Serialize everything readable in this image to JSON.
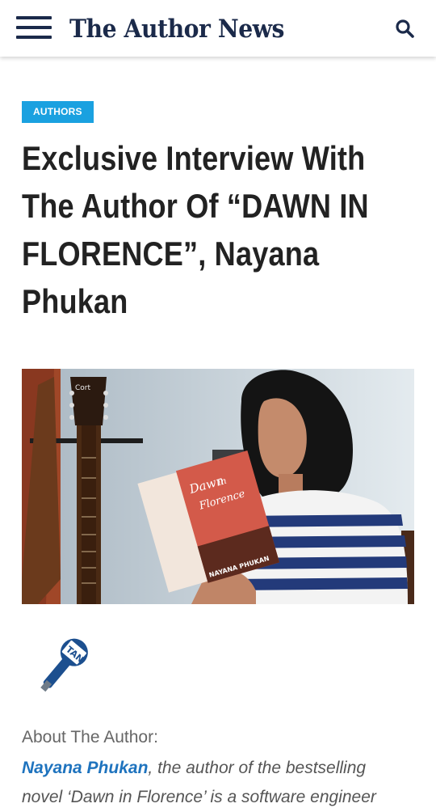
{
  "header": {
    "logo": "The Author News",
    "menu_icon": "hamburger-menu-icon",
    "search_icon": "search-icon",
    "brand_color": "#1b2a4a"
  },
  "article": {
    "category": "AUTHORS",
    "category_color": "#1aa1e0",
    "title": "Exclusive Interview With The Author Of “DAWN IN FLORENCE”, Nayana Phukan",
    "photo": {
      "book_title_line1": "Dawn",
      "book_title_line2": "in",
      "book_title_line3": "Florence",
      "book_author": "NAYANA PHUKAN",
      "guitar_brand": "Cort"
    },
    "mic_logo": "TAN",
    "about_heading": "About The Author:",
    "author_name": "Nayana Phukan",
    "intro_line1": ", the author of the bestselling",
    "intro_line2": "novel ‘Dawn in Florence’ is a software engineer",
    "link_color": "#1e73be"
  }
}
